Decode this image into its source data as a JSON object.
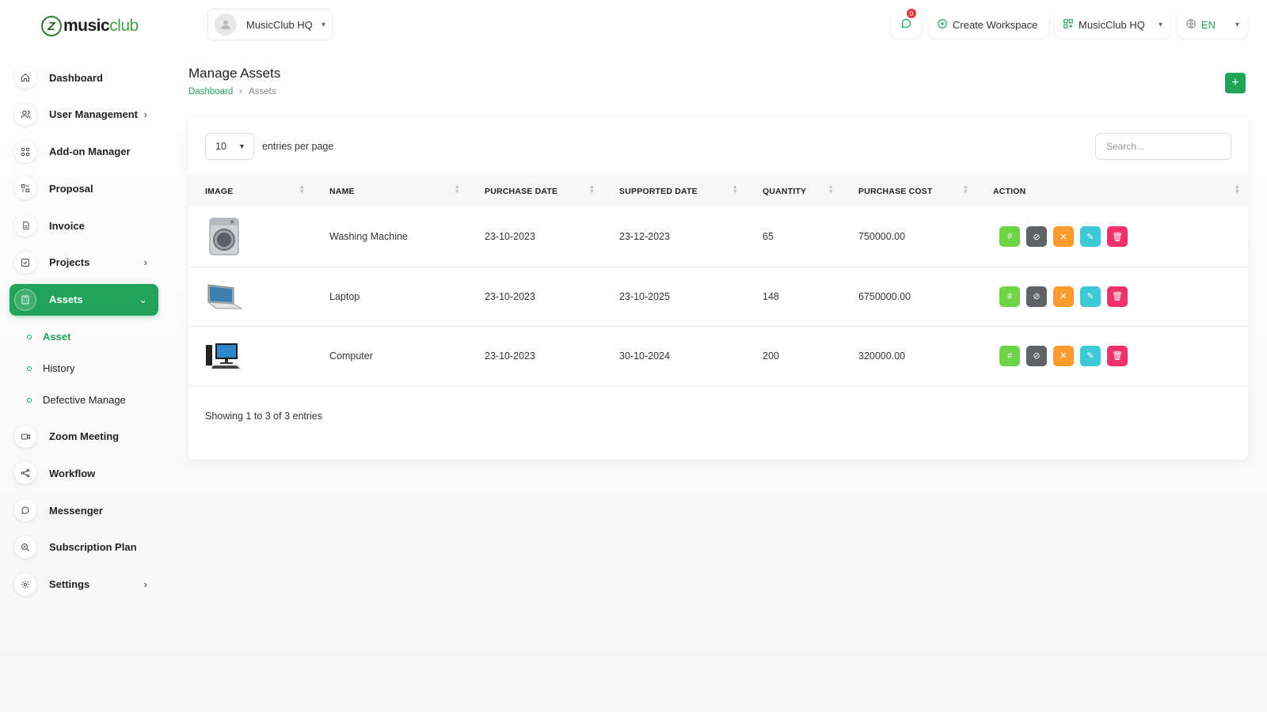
{
  "brand": {
    "logo_mark": "Z",
    "name_part1": "music",
    "name_part2": "club"
  },
  "header": {
    "workspace_select": "MusicClub HQ",
    "notifications_count": "0",
    "create_workspace": "Create Workspace",
    "workspace_switch": "MusicClub HQ",
    "language": "EN"
  },
  "sidebar": {
    "items": [
      {
        "label": "Dashboard",
        "icon": "home-icon"
      },
      {
        "label": "User Management",
        "icon": "users-icon"
      },
      {
        "label": "Add-on Manager",
        "icon": "grid-icon"
      },
      {
        "label": "Proposal",
        "icon": "proposal-icon"
      },
      {
        "label": "Invoice",
        "icon": "file-icon"
      },
      {
        "label": "Projects",
        "icon": "check-square-icon"
      },
      {
        "label": "Assets",
        "icon": "calculator-icon"
      },
      {
        "label": "Zoom Meeting",
        "icon": "video-icon"
      },
      {
        "label": "Workflow",
        "icon": "share-icon"
      },
      {
        "label": "Messenger",
        "icon": "chat-icon"
      },
      {
        "label": "Subscription Plan",
        "icon": "zoom-in-icon"
      },
      {
        "label": "Settings",
        "icon": "gear-icon"
      }
    ],
    "assets_sub": [
      {
        "label": "Asset"
      },
      {
        "label": "History"
      },
      {
        "label": "Defective Manage"
      }
    ]
  },
  "page": {
    "title": "Manage Assets",
    "breadcrumb": {
      "home": "Dashboard",
      "current": "Assets"
    }
  },
  "table": {
    "per_page": "10",
    "per_page_label": "entries per page",
    "search_placeholder": "Search...",
    "columns": [
      "IMAGE",
      "NAME",
      "PURCHASE DATE",
      "SUPPORTED DATE",
      "QUANTITY",
      "PURCHASE COST",
      "ACTION"
    ],
    "rows": [
      {
        "name": "Washing Machine",
        "purchase_date": "23-10-2023",
        "supported_date": "23-12-2023",
        "quantity": "65",
        "cost": "750000.00",
        "image": "washing-machine"
      },
      {
        "name": "Laptop",
        "purchase_date": "23-10-2023",
        "supported_date": "23-10-2025",
        "quantity": "148",
        "cost": "6750000.00",
        "image": "laptop"
      },
      {
        "name": "Computer",
        "purchase_date": "23-10-2023",
        "supported_date": "30-10-2024",
        "quantity": "200",
        "cost": "320000.00",
        "image": "computer"
      }
    ],
    "footer": "Showing 1 to 3 of 3 entries"
  },
  "colors": {
    "accent": "#22a35a",
    "action_green": "#6ed445",
    "action_gray": "#5f6368",
    "action_orange": "#ff9a2d",
    "action_cyan": "#3ec8d6",
    "action_red": "#f0316a"
  }
}
